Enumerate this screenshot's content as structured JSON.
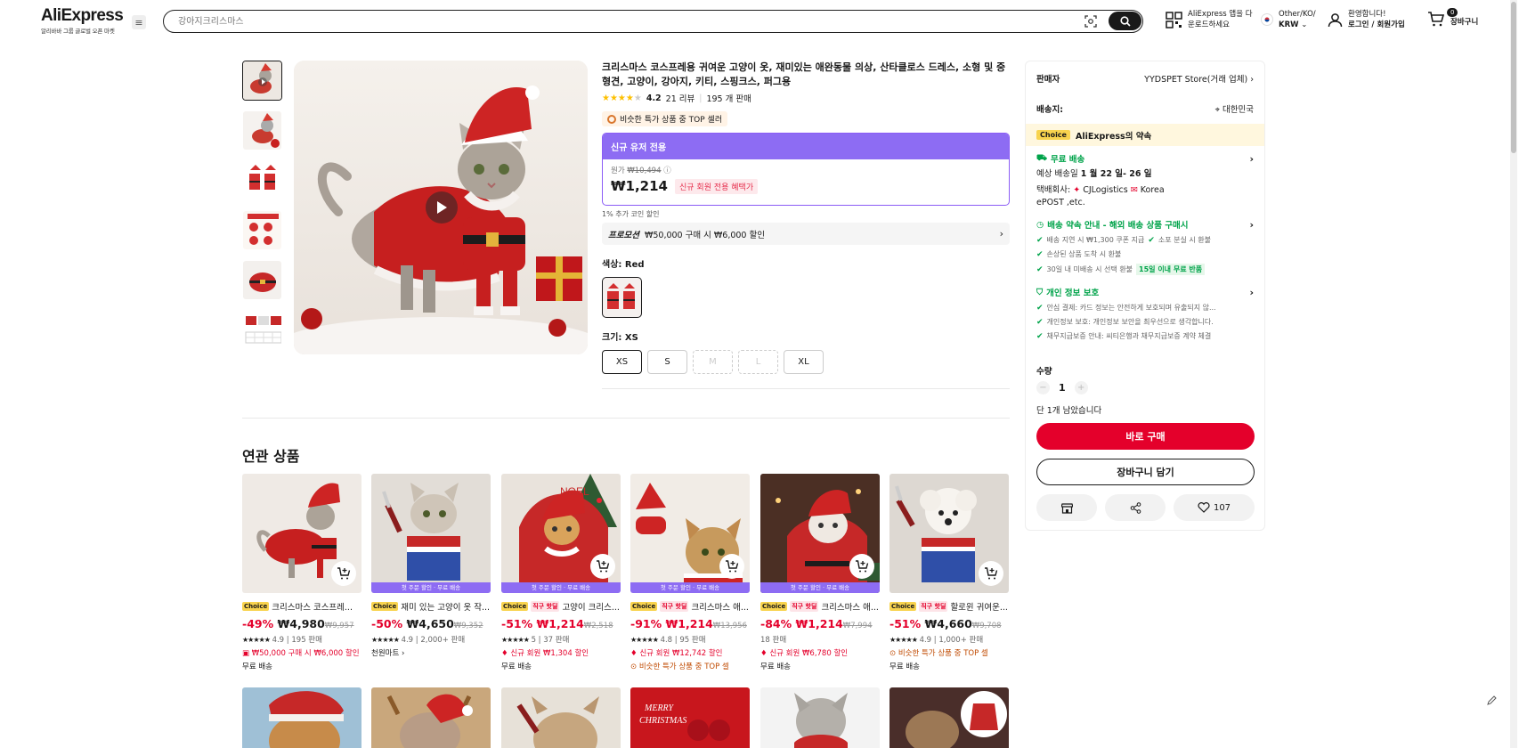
{
  "header": {
    "logo": "AliExpress",
    "logo_sub": "알리바바 그룹 글로벌 오픈 마켓",
    "search_placeholder": "강아지크리스마스",
    "app_download_1": "AliExpress 앱을 다",
    "app_download_2": "운로드하세요",
    "locale_1": "Other/KO/",
    "locale_2": "KRW",
    "welcome": "환영합니다!",
    "login": "로그인 / 회원가입",
    "cart_count": "0",
    "cart_label": "장바구니"
  },
  "product": {
    "title": "크리스마스 코스프레용 귀여운 고양이 옷, 재미있는 애완동물 의상, 산타클로스 드레스, 소형 및 중형견, 고양이, 강아지, 키티, 스핑크스, 퍼그용",
    "rating": "4.2",
    "reviews": "21 리뷰",
    "sold": "195 개 판매",
    "top_seller": "비슷한 특가 상품 중 TOP 셀러",
    "promo_header": "신규 유저 전용",
    "orig_label": "원가",
    "orig_price": "₩10,494",
    "price": "₩1,214",
    "newuser_tag": "신규 회원 전용 혜택가",
    "coin_note": "1% 추가 코인 할인",
    "promotion_label": "프로모션",
    "promotion_text": "₩50,000 구매 시 ₩6,000 할인",
    "color_label": "색상:",
    "color_value": "Red",
    "size_label": "크기:",
    "size_value": "XS",
    "sizes": [
      "XS",
      "S",
      "M",
      "L",
      "XL"
    ]
  },
  "panel": {
    "seller_label": "판매자",
    "seller_name": "YYDSPET Store(거래 업체)",
    "ship_to_label": "배송지:",
    "ship_to": "대한민국",
    "choice_tag": "Choice",
    "choice_promise": "AliExpress의 약속",
    "free_shipping": "무료 배송",
    "eta_prefix": "예상 배송일",
    "eta": "1 월 22 일- 26 일",
    "carrier_label": "택배회사:",
    "carrier": "CJLogistics",
    "carrier_2": "Korea",
    "carrier_3": "ePOST ,etc.",
    "delivery_promise": "배송 약속 안내 - 해외 배송 상품 구매시",
    "dp_1": "배송 지연 시 ₩1,300 쿠폰 지급",
    "dp_2": "소포 분실 시 환불",
    "dp_3": "손상된 상품 도착 시 환불",
    "dp_4": "30일 내 미배송 시 선택 환불",
    "dp_4_tag": "15일 이내 무료 반품",
    "privacy": "개인 정보 보호",
    "pv_1": "안심 결제: 카드 정보는 안전하게 보호되며 유출되지 않...",
    "pv_2": "개인정보 보호: 개인정보 보안을 최우선으로 생각합니다.",
    "pv_3": "채무지급보증 안내: 씨티은행과 채무지급보증 계약 체결",
    "qty_label": "수량",
    "qty": "1",
    "stock_note": "단 1개 남았습니다",
    "buy_now": "바로 구매",
    "add_cart": "장바구니 담기",
    "wishlist_count": "107"
  },
  "related": {
    "title": "연관 상품",
    "band_text": "첫 주문 할인 · 무료 배송",
    "items": [
      {
        "tags": [
          "Choice"
        ],
        "title": "크리스마스 코스프레...",
        "discount": "-49%",
        "price": "₩4,980",
        "orig": "₩9,957",
        "rating": "4.9",
        "sold": "195 판매",
        "extra1": "₩50,000 구매 시 ₩6,000 할인",
        "extra2": "무료 배송"
      },
      {
        "tags": [
          "Choice"
        ],
        "title": "재미 있는 고양이 옷 작...",
        "discount": "-50%",
        "price": "₩4,650",
        "orig": "₩9,352",
        "rating": "4.9",
        "sold": "2,000+ 판매",
        "extra1": "천원마트 ›",
        "extra2": ""
      },
      {
        "tags": [
          "Choice",
          "직구 핫딜"
        ],
        "title": "고양이 크리스...",
        "discount": "-51%",
        "price": "₩1,214",
        "orig": "₩2,518",
        "rating": "5",
        "sold": "37 판매",
        "extra1": "신규 회원 ₩1,304 할인",
        "extra2": "무료 배송"
      },
      {
        "tags": [
          "Choice",
          "직구 핫딜"
        ],
        "title": "크리스마스 애...",
        "discount": "-91%",
        "price": "₩1,214",
        "orig": "₩13,956",
        "rating": "4.8",
        "sold": "95 판매",
        "extra1": "신규 회원 ₩12,742 할인",
        "extra2": "비슷한 특가 상품 중 TOP 셀"
      },
      {
        "tags": [
          "Choice",
          "직구 핫딜"
        ],
        "title": "크리스마스 애...",
        "discount": "-84%",
        "price": "₩1,214",
        "orig": "₩7,994",
        "rating": "",
        "sold": "18 판매",
        "extra1": "신규 회원 ₩6,780 할인",
        "extra2": "무료 배송"
      },
      {
        "tags": [
          "Choice",
          "직구 핫딜"
        ],
        "title": "할로윈 귀여운...",
        "discount": "-51%",
        "price": "₩4,660",
        "orig": "₩9,708",
        "rating": "4.9",
        "sold": "1,000+ 판매",
        "extra1": "비슷한 특가 상품 중 TOP 셀",
        "extra2": "무료 배송"
      }
    ]
  }
}
